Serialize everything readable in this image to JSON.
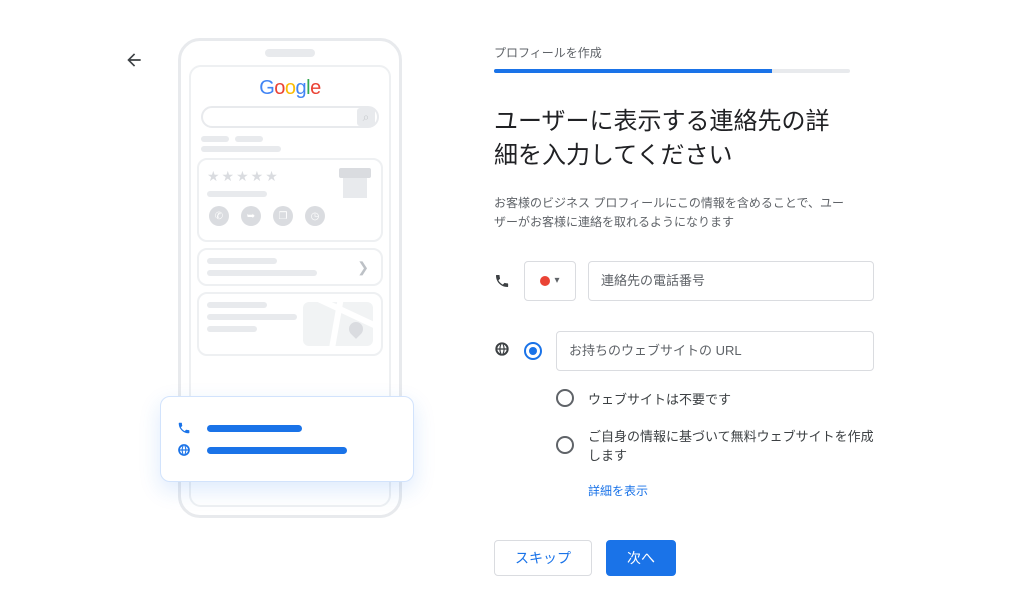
{
  "step_label": "プロフィールを作成",
  "progress_percent": 78,
  "heading": "ユーザーに表示する連絡先の詳細を入力してください",
  "subtext": "お客様のビジネス プロフィールにこの情報を含めることで、ユーザーがお客様に連絡を取れるようになります",
  "phone": {
    "placeholder": "連絡先の電話番号",
    "value": "",
    "country_flag": "jp"
  },
  "website": {
    "selected": "url",
    "options": {
      "url": {
        "placeholder": "お持ちのウェブサイトの URL",
        "value": ""
      },
      "none": {
        "label": "ウェブサイトは不要です"
      },
      "free": {
        "label": "ご自身の情報に基づいて無料ウェブサイトを作成します",
        "details_link": "詳細を表示"
      }
    }
  },
  "buttons": {
    "skip": "スキップ",
    "next": "次へ"
  },
  "illustration_logo_letters": [
    "G",
    "o",
    "o",
    "g",
    "l",
    "e"
  ]
}
